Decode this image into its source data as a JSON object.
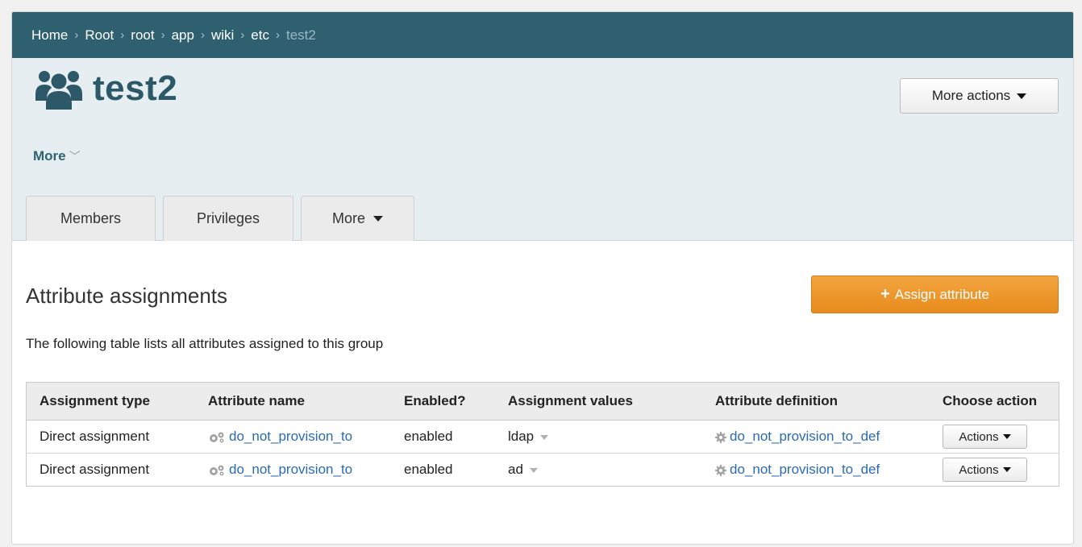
{
  "breadcrumb": {
    "items": [
      "Home",
      "Root",
      "root",
      "app",
      "wiki",
      "etc"
    ],
    "current": "test2",
    "separator": "›"
  },
  "header": {
    "icon": "group-icon",
    "title": "test2",
    "more_link": "More",
    "more_actions_label": "More actions"
  },
  "tabs": [
    {
      "label": "Members"
    },
    {
      "label": "Privileges"
    },
    {
      "label": "More"
    }
  ],
  "main": {
    "section_title": "Attribute assignments",
    "assign_button_label": "Assign attribute",
    "description": "The following table lists all attributes assigned to this group"
  },
  "table": {
    "headers": [
      "Assignment type",
      "Attribute name",
      "Enabled?",
      "Assignment values",
      "Attribute definition",
      "Choose action"
    ],
    "rows": [
      {
        "type": "Direct assignment",
        "name": "do_not_provision_to",
        "enabled": "enabled",
        "value": "ldap",
        "definition": "do_not_provision_to_def",
        "action": "Actions"
      },
      {
        "type": "Direct assignment",
        "name": "do_not_provision_to",
        "enabled": "enabled",
        "value": "ad",
        "definition": "do_not_provision_to_def",
        "action": "Actions"
      }
    ]
  },
  "colors": {
    "breadcrumb_bg": "#2f6070",
    "header_bg": "#e6eef2",
    "accent_orange": "#e78b1c",
    "link": "#2a6ab3"
  }
}
